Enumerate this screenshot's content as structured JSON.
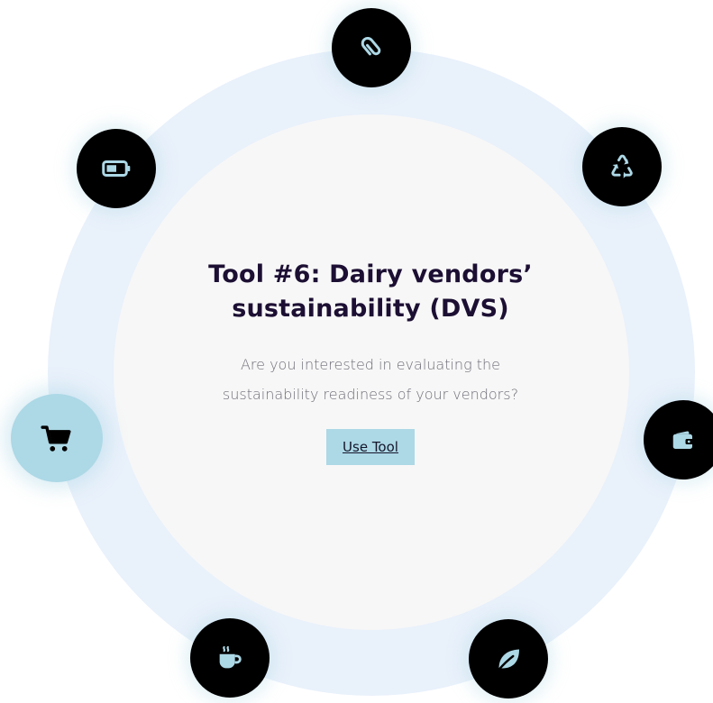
{
  "tool": {
    "title_line1": "Tool #6: Dairy vendors’",
    "title_line2": "sustainability (DVS)",
    "description_line1": "Are you interested in evaluating the",
    "description_line2": "sustainability readiness of your vendors?",
    "button_label": "Use Tool"
  },
  "nodes": [
    {
      "name": "paperclip-icon",
      "active": false
    },
    {
      "name": "recycle-icon",
      "active": false
    },
    {
      "name": "wallet-icon",
      "active": false
    },
    {
      "name": "leaf-icon",
      "active": false
    },
    {
      "name": "coffee-cup-icon",
      "active": false
    },
    {
      "name": "shopping-cart-icon",
      "active": true
    },
    {
      "name": "battery-icon",
      "active": false
    }
  ],
  "colors": {
    "ring": "#e9f1fb",
    "disc": "#f7f7f7",
    "node": "#000000",
    "accent": "#add8e6",
    "title": "#1c0f33",
    "body_text": "#6e6e78"
  }
}
